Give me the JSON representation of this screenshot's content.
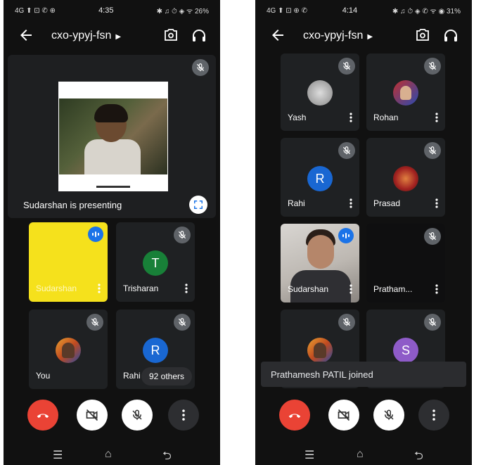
{
  "left": {
    "status": {
      "left": "4G ⬆ ⊡ ✆ ⊕",
      "time": "4:35",
      "right": "✱ ♫ ⏱ ◈ ᯤ 26%"
    },
    "meeting_code": "cxo-ypyj-fsn",
    "presenting_caption": "Sudarshan is presenting",
    "tiles": [
      {
        "name": "Sudarshan",
        "bg": "#f5e11c"
      },
      {
        "name": "Trisharan",
        "initial": "T",
        "avatar_color": "#188038"
      },
      {
        "name": "You"
      },
      {
        "name": "Rahi",
        "initial": "R",
        "avatar_color": "#1967d2"
      }
    ],
    "others_label": "92 others"
  },
  "right": {
    "status": {
      "left": "4G ⬆ ⊡ ⊕ ✆",
      "time": "4:14",
      "right": "✱ ♫ ⏱ ◈ ✆ ᯤ ◉ 31%"
    },
    "meeting_code": "cxo-ypyj-fsn",
    "tiles": [
      {
        "name": "Yash"
      },
      {
        "name": "Rohan"
      },
      {
        "name": "Rahi",
        "initial": "R",
        "avatar_color": "#1967d2"
      },
      {
        "name": "Prasad"
      },
      {
        "name": "Sudarshan"
      },
      {
        "name": "Pratham..."
      },
      {
        "name": ""
      },
      {
        "name": "",
        "initial": "S",
        "avatar_color": "#8e5bc8"
      }
    ],
    "toast": "Prathamesh PATIL joined"
  },
  "colors": {
    "end_call": "#ea4335",
    "speaking": "#1a73e8",
    "tile_bg": "#1f2123"
  }
}
